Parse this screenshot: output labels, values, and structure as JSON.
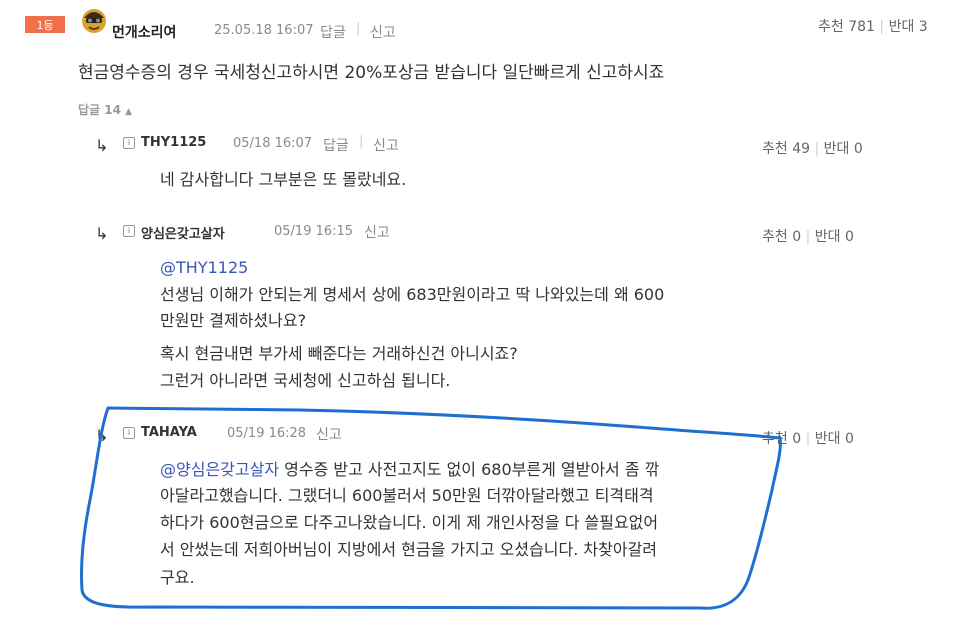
{
  "main": {
    "rank": "1등",
    "author": "먼개소리여",
    "date": "25.05.18 16:07",
    "reply_label": "답글",
    "report_label": "신고",
    "recommend_label": "추천",
    "recommend_count": "781",
    "oppose_label": "반대",
    "oppose_count": "3",
    "text": "현금영수증의 경우 국세청신고하시면 20%포상금 받습니다 일단빠르게 신고하시죠",
    "reply_toggle_label": "답글",
    "reply_toggle_count": "14"
  },
  "replies": [
    {
      "author": "THY1125",
      "date": "05/18 16:07",
      "reply_label": "답글",
      "report_label": "신고",
      "recommend_label": "추천",
      "recommend_count": "49",
      "oppose_label": "반대",
      "oppose_count": "0",
      "lines": [
        "네 감사합니다 그부분은 또 몰랐네요."
      ]
    },
    {
      "author": "양심은갖고살자",
      "date": "05/19 16:15",
      "report_label": "신고",
      "recommend_label": "추천",
      "recommend_count": "0",
      "oppose_label": "반대",
      "oppose_count": "0",
      "mention": "@THY1125",
      "lines": [
        "선생님 이해가 안되는게 명세서 상에 683만원이라고 딱 나와있는데 왜 600",
        "만원만 결제하셨나요?",
        "혹시 현금내면 부가세 빼준다는 거래하신건 아니시죠?",
        "그런거 아니라면 국세청에 신고하심 됩니다."
      ]
    },
    {
      "author": "TAHAYA",
      "date": "05/19 16:28",
      "report_label": "신고",
      "recommend_label": "추천",
      "recommend_count": "0",
      "oppose_label": "반대",
      "oppose_count": "0",
      "mention": "@양심은갖고살자",
      "first_line_rest": " 영수증 받고 사전고지도 없이 680부른게 열받아서 좀 깎",
      "lines": [
        "아달라고했습니다. 그랬더니 600불러서 50만원 더깎아달라했고 티격태격",
        "하다가 600현금으로 다주고나왔습니다. 이게 제 개인사정을 다 쓸필요없어",
        "서 안썼는데 저희아버님이 지방에서 현금을 가지고 오셨습니다. 차찾아갈려",
        "구요."
      ]
    }
  ],
  "annotation": {
    "color": "#1f6fd1"
  }
}
